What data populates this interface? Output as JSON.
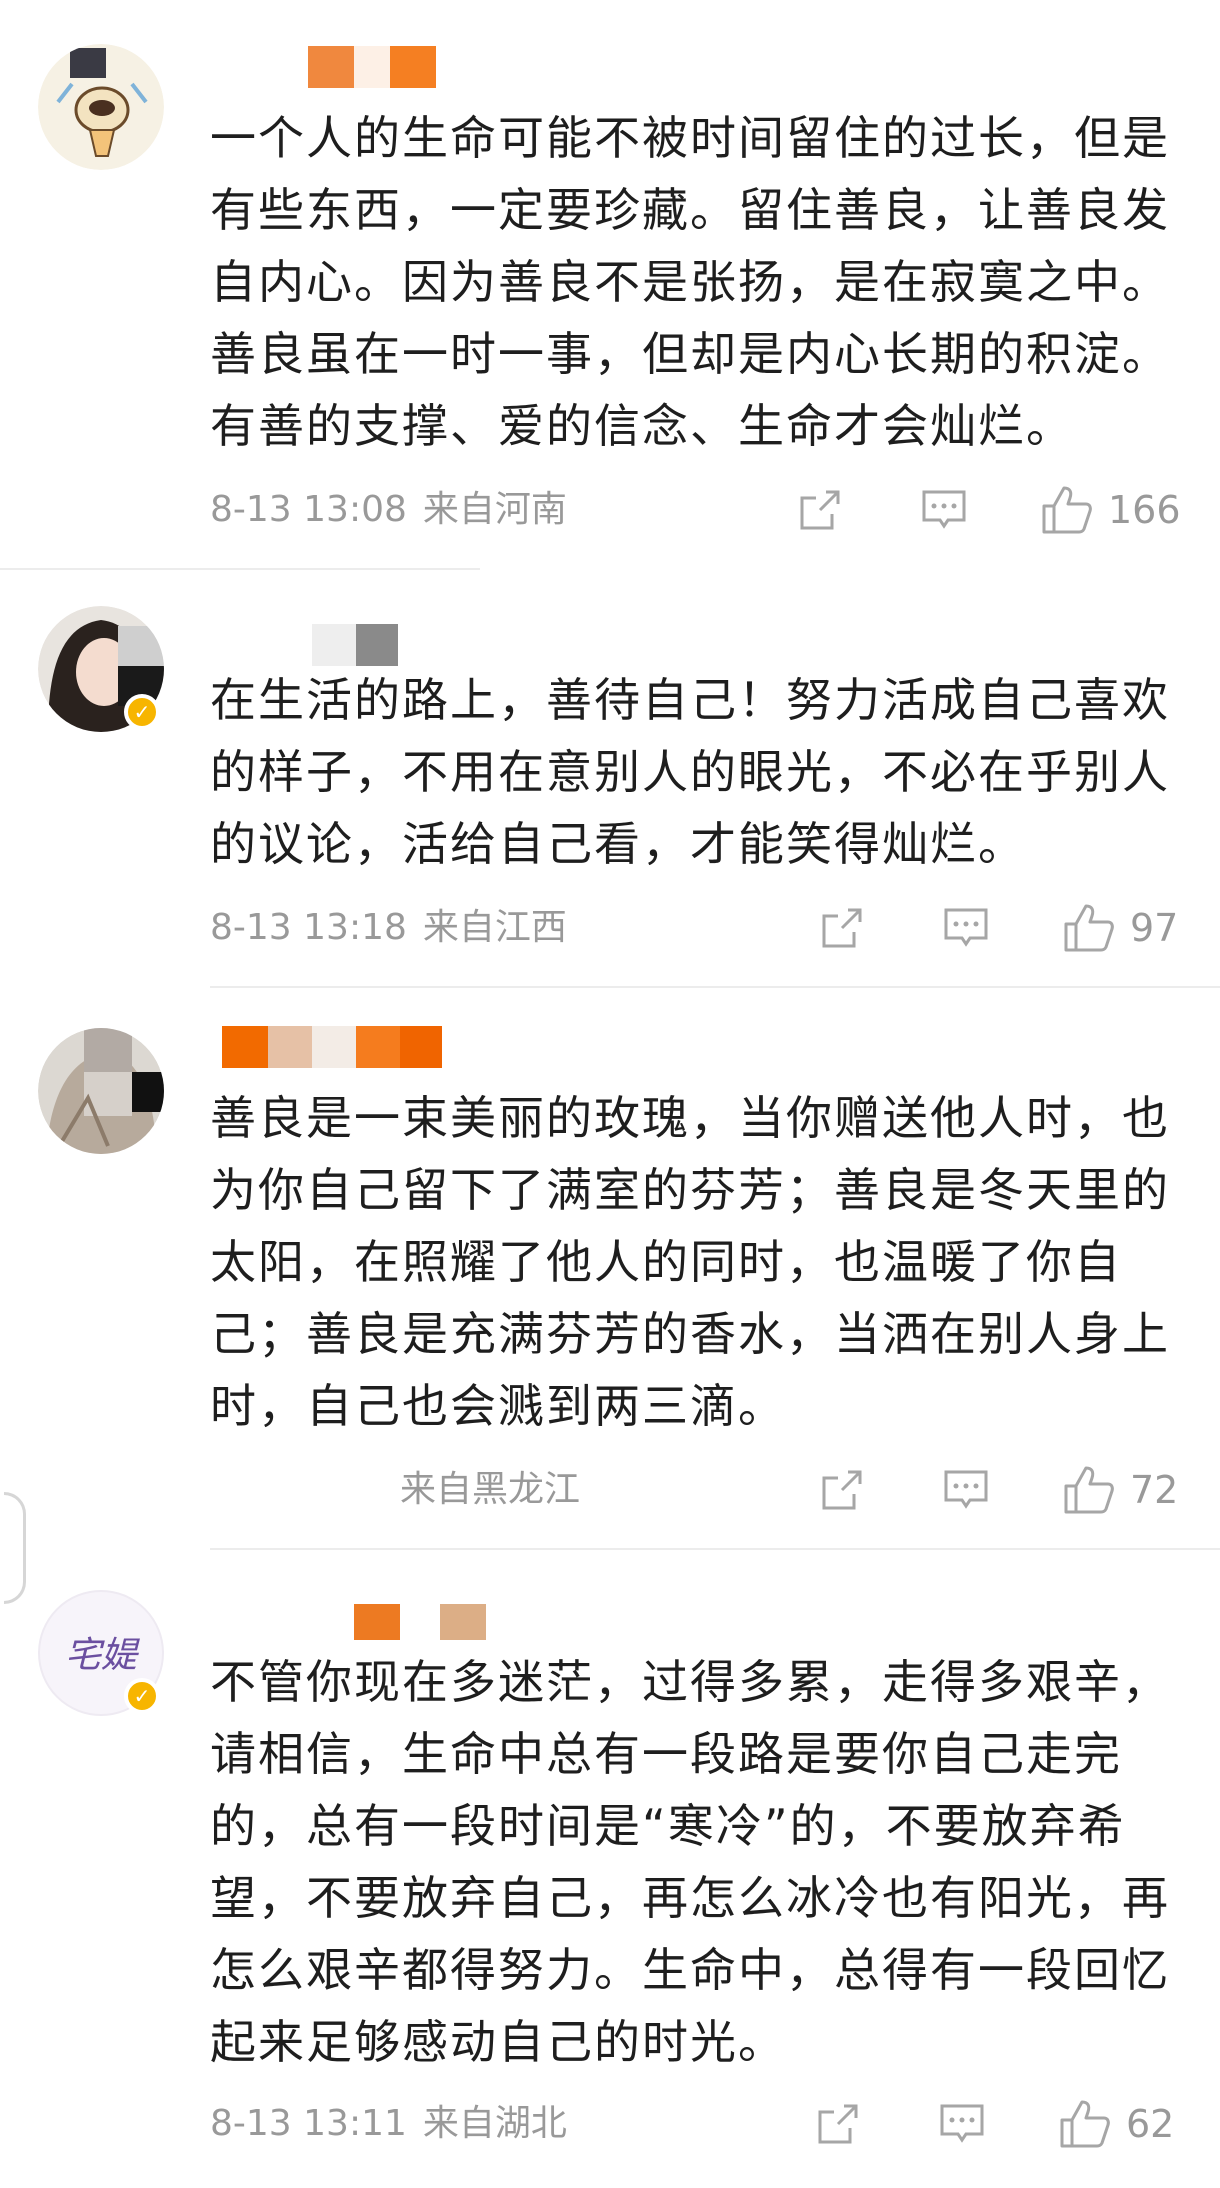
{
  "comments": [
    {
      "text": "一个人的生命可能不被时间留住的过长，但是有些东西，一定要珍藏。留住善良，让善良发自内心。因为善良不是张扬，是在寂寞之中。善良虽在一时一事，但却是内心长期的积淀。有善的支撑、爱的信念、生命才会灿烂。",
      "time": "8-13 13:08",
      "location": "来自河南",
      "likes": "166"
    },
    {
      "text": "在生活的路上，善待自己！努力活成自己喜欢的样子，不用在意别人的眼光，不必在乎别人的议论，活给自己看，才能笑得灿烂。",
      "time": "8-13 13:18",
      "location": "来自江西",
      "likes": "97"
    },
    {
      "text": "善良是一束美丽的玫瑰，当你赠送他人时，也为你自己留下了满室的芬芳；善良是冬天里的太阳，在照耀了他人的同时，也温暖了你自己；善良是充满芬芳的香水，当洒在别人身上时，自己也会溅到两三滴。",
      "time": "",
      "location": "来自黑龙江",
      "likes": "72"
    },
    {
      "text": "不管你现在多迷茫，过得多累，走得多艰辛，请相信，生命中总有一段路是要你自己走完的，总有一段时间是“寒冷”的，不要放弃希望，不要放弃自己，再怎么冰冷也有阳光，再怎么艰辛都得努力。生命中，总得有一段回忆起来足够感动自己的时光。",
      "time": "8-13 13:11",
      "location": "来自湖北",
      "likes": "62"
    }
  ],
  "avatar4_text": "宅媞",
  "icons": {
    "share": "share-icon",
    "comment": "comment-icon",
    "like": "thumbs-up-icon",
    "verified": "verified-badge-icon"
  },
  "colors": {
    "verified": "#f7b500",
    "meta": "#999999",
    "text": "#1e1e1e"
  }
}
